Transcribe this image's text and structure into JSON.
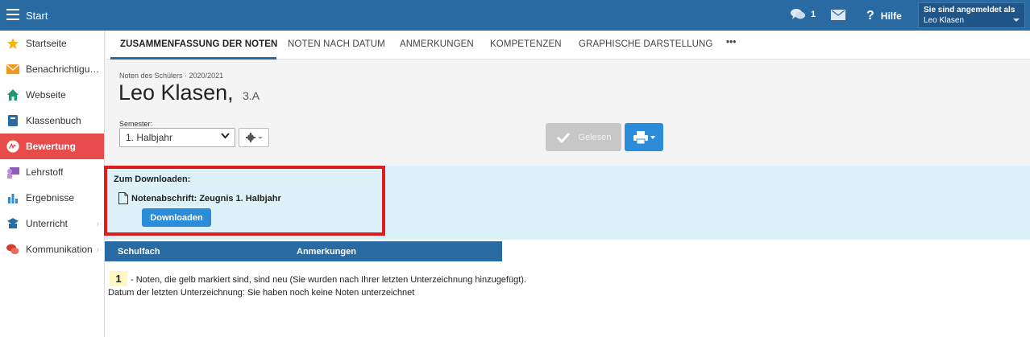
{
  "header": {
    "title": "Start",
    "chat_count": "1",
    "help_label": "Hilfe",
    "user_label": "Sie sind angemeldet als",
    "user_name": "Leo Klasen"
  },
  "sidebar": {
    "items": [
      {
        "label": "Startseite",
        "icon": "star-icon"
      },
      {
        "label": "Benachrichtigungen",
        "icon": "envelope-icon"
      },
      {
        "label": "Webseite",
        "icon": "home-icon"
      },
      {
        "label": "Klassenbuch",
        "icon": "book-icon"
      },
      {
        "label": "Bewertung",
        "icon": "grade-icon",
        "active": true
      },
      {
        "label": "Lehrstoff",
        "icon": "teacher-icon"
      },
      {
        "label": "Ergebnisse",
        "icon": "bar-chart-icon"
      },
      {
        "label": "Unterricht",
        "icon": "school-icon"
      },
      {
        "label": "Kommunikation",
        "icon": "chat-icon"
      }
    ]
  },
  "tabs": [
    {
      "label": "ZUSAMMENFASSUNG DER NOTEN",
      "active": true
    },
    {
      "label": "NOTEN NACH DATUM"
    },
    {
      "label": "ANMERKUNGEN"
    },
    {
      "label": "KOMPETENZEN"
    },
    {
      "label": "GRAPHISCHE DARSTELLUNG"
    },
    {
      "label": "•••"
    }
  ],
  "page": {
    "subtitle": "Noten des Schülers · 2020/2021",
    "student_name": "Leo Klasen,",
    "student_class": "3.A",
    "semester_label": "Semester:",
    "semester_value": "1. Halbjahr",
    "read_button": "Gelesen"
  },
  "download": {
    "title": "Zum Downloaden:",
    "file_name": "Notenabschrift: Zeugnis 1. Halbjahr",
    "button": "Downloaden"
  },
  "table": {
    "columns": [
      "Schulfach",
      "Anmerkungen"
    ]
  },
  "legend": {
    "badge": "1",
    "text": "- Noten, die gelb markiert sind, sind neu (Sie wurden nach Ihrer letzten Unterzeichnung hinzugefügt).",
    "signature": "Datum der letzten Unterzeichnung: Sie haben noch keine Noten unterzeichnet"
  },
  "colors": {
    "primary": "#2a6aa3",
    "active_nav": "#e84b4b",
    "button_blue": "#2b8cd9",
    "highlight_border": "#e11c1c",
    "download_band": "#dcf1f8"
  }
}
